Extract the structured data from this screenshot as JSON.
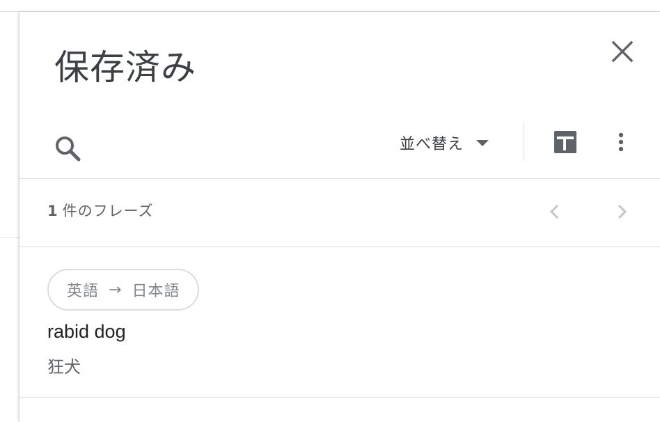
{
  "panel": {
    "title": "保存済み"
  },
  "toolbar": {
    "sort_label": "並べ替え"
  },
  "list": {
    "count": "1",
    "count_suffix": "件のフレーズ"
  },
  "entries": [
    {
      "source_lang": "英語",
      "arrow": "→",
      "target_lang": "日本語",
      "source_text": "rabid dog",
      "target_text": "狂犬"
    }
  ],
  "icons": {
    "close": "close-icon",
    "search": "search-icon",
    "sort_caret": "caret-down-icon",
    "sheets": "sheets-icon",
    "more": "more-vert-icon",
    "prev": "chevron-left-icon",
    "next": "chevron-right-icon"
  },
  "colors": {
    "title": "#3c4043",
    "icon": "#5f6368",
    "icon_disabled": "#c4c7c5",
    "divider": "#dadce0",
    "chip_text": "#80868b"
  }
}
